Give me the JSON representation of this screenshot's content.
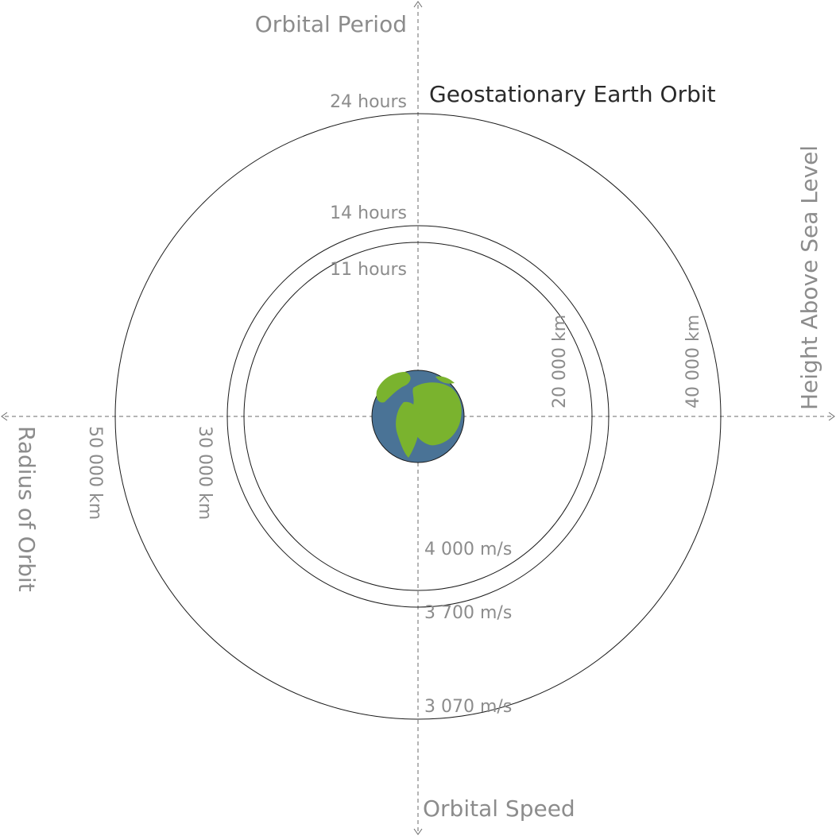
{
  "title": "Geostationary Earth Orbit",
  "axes": {
    "top": "Orbital Period",
    "bottom": "Orbital Speed",
    "right": "Height Above Sea Level",
    "left": "Radius of Orbit"
  },
  "orbits": [
    {
      "period": "24 hours",
      "speed": "3 070 m/s",
      "radius": "50 000 km",
      "height": "40 000 km"
    },
    {
      "period": "14 hours",
      "speed": "3 700 m/s",
      "radius": "30 000 km",
      "height": "20 000 km"
    },
    {
      "period": "11 hours",
      "speed": "4 000 m/s"
    }
  ],
  "colors": {
    "ocean": "#4a7396",
    "land": "#7ab32e"
  },
  "icons": [
    "earth-icon"
  ]
}
